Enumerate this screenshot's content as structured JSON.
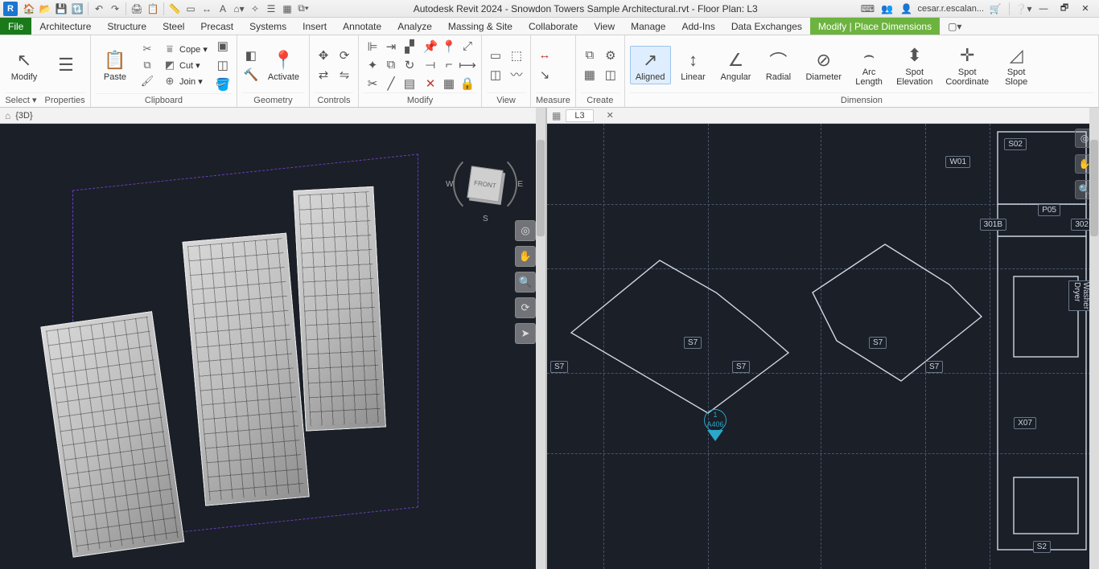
{
  "app": {
    "title": "Autodesk Revit 2024 - Snowdon Towers Sample Architectural.rvt - Floor Plan: L3",
    "user": "cesar.r.escalan...",
    "logo": "R"
  },
  "tabs": {
    "file": "File",
    "items": [
      "Architecture",
      "Structure",
      "Steel",
      "Precast",
      "Systems",
      "Insert",
      "Annotate",
      "Analyze",
      "Massing & Site",
      "Collaborate",
      "View",
      "Manage",
      "Add-Ins",
      "Data Exchanges"
    ],
    "active": "Modify | Place Dimensions"
  },
  "ribbon": {
    "select_panel": {
      "modify": "Modify",
      "select": "Select ▾",
      "properties": "Properties"
    },
    "clipboard": {
      "paste": "Paste",
      "cope": "Cope ▾",
      "cut": "Cut ▾",
      "join": "Join ▾",
      "label": "Clipboard"
    },
    "geometry": {
      "activate": "Activate",
      "label": "Geometry"
    },
    "controls": {
      "label": "Controls"
    },
    "modify": {
      "label": "Modify"
    },
    "view": {
      "label": "View"
    },
    "measure": {
      "label": "Measure"
    },
    "create": {
      "label": "Create"
    },
    "dimension": {
      "label": "Dimension",
      "aligned": "Aligned",
      "linear": "Linear",
      "angular": "Angular",
      "radial": "Radial",
      "diameter": "Diameter",
      "arc": "Arc\nLength",
      "spot_elev": "Spot\nElevation",
      "spot_coord": "Spot\nCoordinate",
      "spot_slope": "Spot\nSlope"
    }
  },
  "views": {
    "left": "{3D}",
    "right": "L3",
    "cube": "FRONT"
  },
  "plan_tags": {
    "s02": "S02",
    "w01": "W01",
    "p05": "P05",
    "r301b": "301B",
    "x07": "X07",
    "s2": "S2",
    "cam_num": "1",
    "cam_sheet": "A406",
    "s7": "S7",
    "washer": "Washer\nDryer",
    "r302": "302"
  },
  "compass": {
    "w": "W",
    "e": "E",
    "s": "S"
  }
}
